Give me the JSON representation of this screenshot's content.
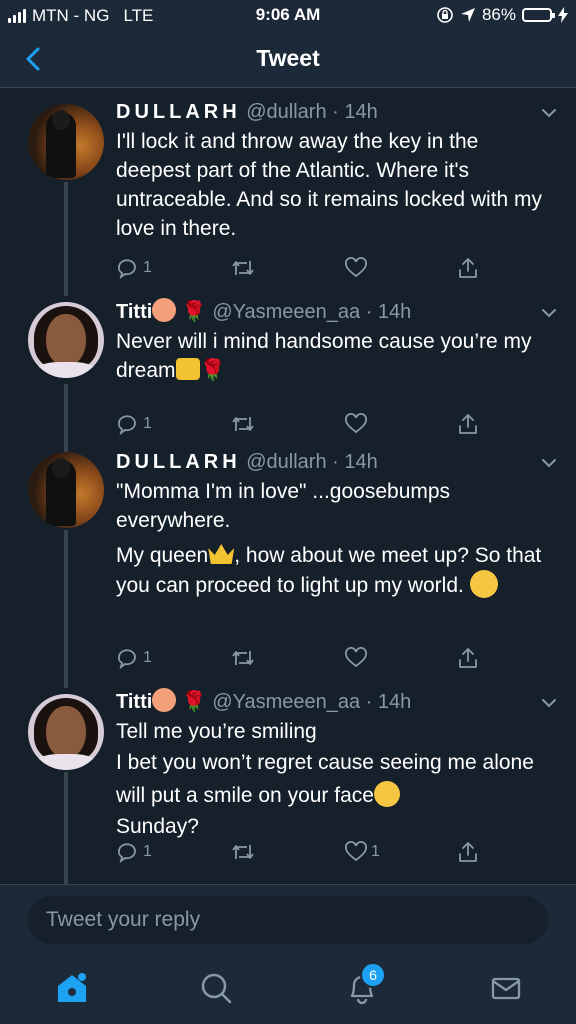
{
  "status": {
    "carrier": "MTN - NG",
    "network": "LTE",
    "time": "9:06 AM",
    "battery": "86%",
    "battery_level": 0.86
  },
  "nav": {
    "title": "Tweet"
  },
  "tweets": [
    {
      "display_name": "DULLARH",
      "handle": "@dullarh",
      "time": "14h",
      "paragraphs": [
        "I'll lock it and throw away the key in the deepest part of the Atlantic. Where it's untraceable. And so it remains locked with my love in there."
      ],
      "replies": "1",
      "retweets": "",
      "likes": ""
    },
    {
      "display_name": "Titti",
      "handle": "@Yasmeeen_aa",
      "time": "14h",
      "text_a": "Never will i mind handsome cause you’re my dream",
      "replies": "1",
      "retweets": "",
      "likes": ""
    },
    {
      "display_name": "DULLARH",
      "handle": "@dullarh",
      "time": "14h",
      "p1": "\"Momma I'm in love\" ...goosebumps everywhere.",
      "p2a": "My queen",
      "p2b": ", how about we meet up? So that you can proceed to light up my world.",
      "replies": "1",
      "retweets": "",
      "likes": ""
    },
    {
      "display_name": "Titti",
      "handle": "@Yasmeeen_aa",
      "time": "14h",
      "line1": "Tell me you’re smiling",
      "line2": "I bet you won’t regret cause seeing me alone will put a smile on your face",
      "line3": "Sunday?",
      "replies": "1",
      "retweets": "",
      "likes": "1"
    }
  ],
  "reply": {
    "placeholder": "Tweet your reply"
  },
  "tabs": {
    "notifications_count": "6"
  },
  "colors": {
    "background": "#15202b",
    "bar": "#1c2938",
    "accent": "#1da1f2",
    "muted": "#8899a6"
  }
}
